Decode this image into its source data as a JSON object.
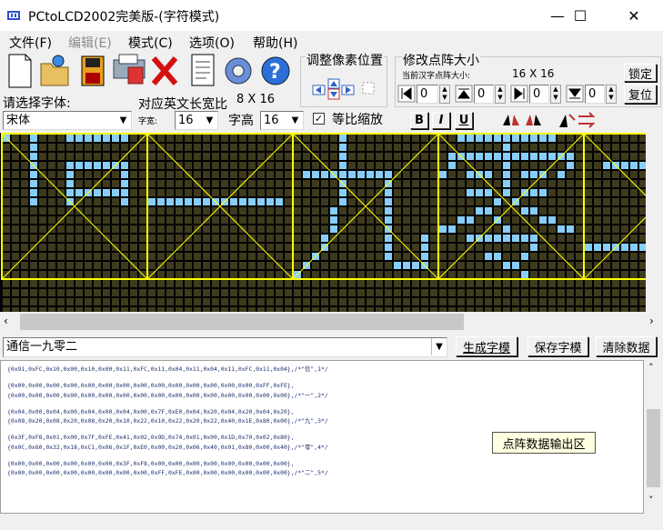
{
  "window": {
    "title": "PCtoLCD2002完美版-(字符模式)",
    "minimize": "—",
    "maximize": "☐",
    "close": "✕"
  },
  "menu": [
    {
      "label": "文件(F)",
      "enabled": true
    },
    {
      "label": "编辑(E)",
      "enabled": false
    },
    {
      "label": "模式(C)",
      "enabled": true
    },
    {
      "label": "选项(O)",
      "enabled": true
    },
    {
      "label": "帮助(H)",
      "enabled": true
    }
  ],
  "toolbar": {
    "icons": [
      "new-file-icon",
      "open-folder-icon",
      "save-disk-icon",
      "print-icon",
      "delete-x-icon",
      "notepad-icon",
      "settings-gear-icon",
      "help-question-icon"
    ],
    "font_select_label": "请选择字体:",
    "font_value": "宋体",
    "ratio_label": "对应英文长宽比",
    "ratio_value": "8 X 16",
    "char_width_label": "字宽:",
    "char_width_value": "16",
    "char_height_label": "字高",
    "char_height_value": "16",
    "keep_ratio_label": "等比缩放",
    "keep_ratio_checked": true,
    "bold": "B",
    "italic": "I",
    "underline": "U",
    "adjust_title": "调整像素位置",
    "resize_title": "修改点阵大小",
    "current_size_label": "当前汉字点阵大小:",
    "current_size_value": "16  X  16",
    "lock_button": "锁定",
    "reset_button": "复位",
    "spin_values": [
      "0",
      "0",
      "0",
      "0"
    ]
  },
  "grid": {
    "text": "通信一九零二",
    "cell_color": "#3d3a1e",
    "on_color": "#87cefa",
    "line_color": "#ffff00"
  },
  "input": {
    "value": "通信一九零二",
    "generate_button": "生成字模",
    "save_button": "保存字模",
    "clear_button": "清除数据"
  },
  "output": {
    "lines": [
      "{0x91,0xFC,0x10,0x00,0x10,0x00,0x11,0xFC,0x11,0x04,0x11,0x04,0x11,0xFC,0x11,0x04},/*\"信\",1*/",
      "",
      "{0x00,0x00,0x00,0x00,0x00,0x00,0x00,0x00,0x00,0x00,0x00,0x00,0x00,0x00,0xFF,0xFE},",
      "{0x00,0x00,0x00,0x00,0x00,0x00,0x00,0x00,0x00,0x00,0x00,0x00,0x00,0x00,0x00,0x00},/*\"一\",2*/",
      "",
      "{0x04,0x00,0x04,0x00,0x04,0x00,0x04,0x00,0x7F,0xE0,0x04,0x20,0x04,0x20,0x04,0x20},",
      "{0x08,0x20,0x08,0x20,0x08,0x20,0x10,0x22,0x10,0x22,0x20,0x22,0x40,0x1E,0x80,0x00},/*\"九\",3*/",
      "",
      "{0x3F,0xF8,0x01,0x00,0x7F,0xFE,0x41,0x02,0x9D,0x74,0x01,0x00,0x1D,0x70,0x02,0x80},",
      "{0x0C,0x60,0x32,0x18,0xC1,0x06,0x1F,0xE0,0x00,0x20,0x06,0x40,0x01,0x80,0x00,0x40},/*\"零\",4*/",
      "",
      "{0x00,0x00,0x00,0x00,0x00,0x00,0x3F,0xF8,0x00,0x00,0x00,0x00,0x00,0x00,0x00,0x00},",
      "{0x00,0x00,0x00,0x00,0x00,0x00,0x00,0x00,0xFF,0xFE,0x00,0x00,0x00,0x00,0x00,0x00},/*\"二\",5*/"
    ],
    "tooltip": "点阵数据输出区"
  }
}
